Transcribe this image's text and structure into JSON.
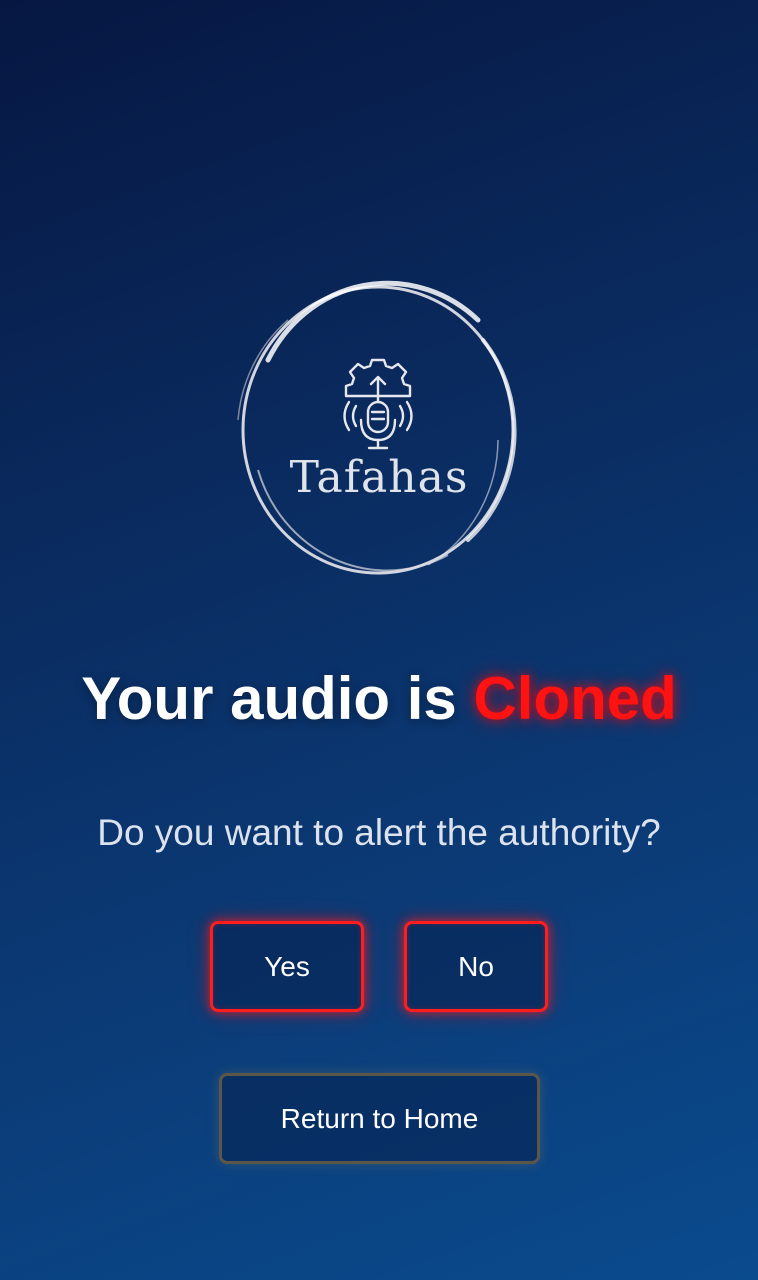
{
  "brand": {
    "name": "Tafahas",
    "icon": "microphone-gear-icon"
  },
  "headline": {
    "prefix": "Your audio is ",
    "highlight": "Cloned"
  },
  "question": "Do you want to alert the authority?",
  "actions": {
    "yes_label": "Yes",
    "no_label": "No",
    "home_label": "Return to Home"
  },
  "colors": {
    "accent_red": "#ff1212",
    "background_top": "#061742",
    "background_bottom": "#0a4b8e",
    "home_border": "#5c5648"
  }
}
